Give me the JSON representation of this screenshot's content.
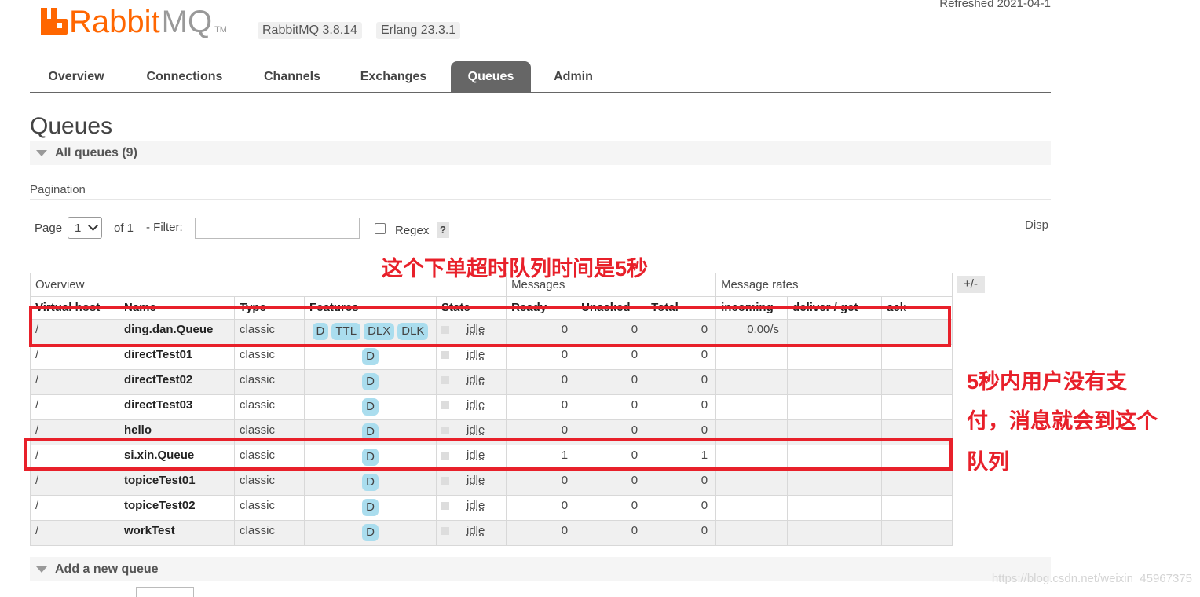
{
  "app": {
    "logo_rabbit": "Rabbit",
    "logo_mq": "MQ",
    "logo_tm": "TM",
    "version_rabbitmq": "RabbitMQ 3.8.14",
    "version_erlang": "Erlang 23.3.1",
    "refreshed": "Refreshed 2021-04-1"
  },
  "nav": {
    "tabs": [
      "Overview",
      "Connections",
      "Channels",
      "Exchanges",
      "Queues",
      "Admin"
    ],
    "active": "Queues"
  },
  "page": {
    "title": "Queues",
    "all_queues_label": "All queues (9)",
    "pagination_label": "Pagination",
    "page_label": "Page",
    "page_value": "1",
    "of_label": "of 1",
    "filter_label": "- Filter:",
    "filter_value": "",
    "regex_label": "Regex",
    "help_label": "?",
    "disp_label": "Disp",
    "plus_minus": "+/-",
    "add_queue_label": "Add a new queue"
  },
  "table": {
    "groups": [
      "Overview",
      "Messages",
      "Message rates"
    ],
    "columns": [
      "Virtual host",
      "Name",
      "Type",
      "Features",
      "State",
      "Ready",
      "Unacked",
      "Total",
      "incoming",
      "deliver / get",
      "ack"
    ],
    "rows": [
      {
        "vhost": "/",
        "name": "ding.dan.Queue",
        "type": "classic",
        "features": [
          "D",
          "TTL",
          "DLX",
          "DLK"
        ],
        "state": "idle",
        "ready": "0",
        "unacked": "0",
        "total": "0",
        "incoming": "0.00/s",
        "deliver": "",
        "ack": ""
      },
      {
        "vhost": "/",
        "name": "directTest01",
        "type": "classic",
        "features": [
          "D"
        ],
        "state": "idle",
        "ready": "0",
        "unacked": "0",
        "total": "0",
        "incoming": "",
        "deliver": "",
        "ack": ""
      },
      {
        "vhost": "/",
        "name": "directTest02",
        "type": "classic",
        "features": [
          "D"
        ],
        "state": "idle",
        "ready": "0",
        "unacked": "0",
        "total": "0",
        "incoming": "",
        "deliver": "",
        "ack": ""
      },
      {
        "vhost": "/",
        "name": "directTest03",
        "type": "classic",
        "features": [
          "D"
        ],
        "state": "idle",
        "ready": "0",
        "unacked": "0",
        "total": "0",
        "incoming": "",
        "deliver": "",
        "ack": ""
      },
      {
        "vhost": "/",
        "name": "hello",
        "type": "classic",
        "features": [
          "D"
        ],
        "state": "idle",
        "ready": "0",
        "unacked": "0",
        "total": "0",
        "incoming": "",
        "deliver": "",
        "ack": ""
      },
      {
        "vhost": "/",
        "name": "si.xin.Queue",
        "type": "classic",
        "features": [
          "D"
        ],
        "state": "idle",
        "ready": "1",
        "unacked": "0",
        "total": "1",
        "incoming": "",
        "deliver": "",
        "ack": ""
      },
      {
        "vhost": "/",
        "name": "topiceTest01",
        "type": "classic",
        "features": [
          "D"
        ],
        "state": "idle",
        "ready": "0",
        "unacked": "0",
        "total": "0",
        "incoming": "",
        "deliver": "",
        "ack": ""
      },
      {
        "vhost": "/",
        "name": "topiceTest02",
        "type": "classic",
        "features": [
          "D"
        ],
        "state": "idle",
        "ready": "0",
        "unacked": "0",
        "total": "0",
        "incoming": "",
        "deliver": "",
        "ack": ""
      },
      {
        "vhost": "/",
        "name": "workTest",
        "type": "classic",
        "features": [
          "D"
        ],
        "state": "idle",
        "ready": "0",
        "unacked": "0",
        "total": "0",
        "incoming": "",
        "deliver": "",
        "ack": ""
      }
    ]
  },
  "annotations": {
    "top_note": "这个下单超时队列时间是5秒",
    "side_note_lines": [
      "5秒内用户没有支",
      "付，消息就会到这个",
      "队列"
    ]
  },
  "watermark": "https://blog.csdn.net/weixin_45967375",
  "colors": {
    "brand_orange": "#ff6600",
    "active_tab": "#666666",
    "badge": "#aaddee",
    "annotation_red": "#e8202a"
  }
}
